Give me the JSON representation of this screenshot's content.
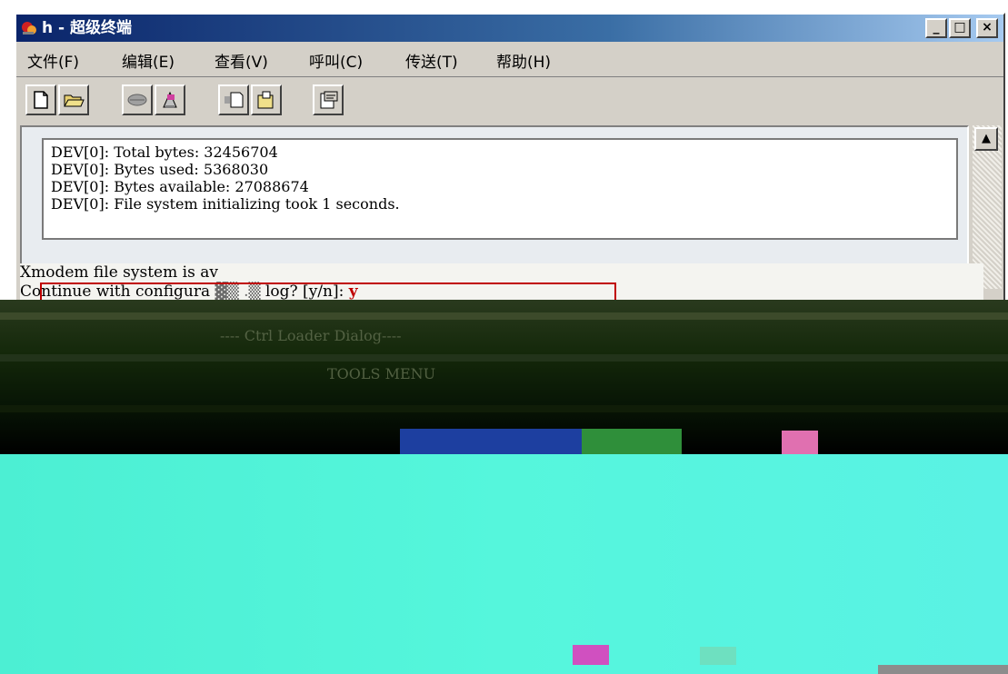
{
  "window": {
    "title": "h - 超级终端",
    "min_label": "_",
    "max_label": "□",
    "close_label": "×"
  },
  "menu": {
    "items": [
      "文件(F)",
      "编辑(E)",
      "查看(V)",
      "呼叫(C)",
      "传送(T)",
      "帮助(H)"
    ]
  },
  "toolbar": {
    "icons": [
      "new-icon",
      "open-icon",
      "disconnect-icon",
      "connect-icon",
      "send-icon",
      "receive-icon",
      "properties-icon"
    ]
  },
  "terminal": {
    "lines": [
      "DEV[0]: Total bytes: 32456704",
      "DEV[0]: Bytes used: 5368030",
      "DEV[0]: Bytes available: 27088674",
      "DEV[0]: File system initializing took 1 seconds."
    ],
    "line5": "Xmodem file system is av",
    "line6_prefix": "Continue with configura",
    "line6_suffix": "log? [y/n]: ",
    "answer": "y",
    "loader_title": "---- Ctrl Loader Dialog----",
    "tools_menu": "TOOLS MENU"
  },
  "colors": {
    "title_bar_start": "#0a246a",
    "highlight": "#c00000",
    "cyan_area": "#55f6dc"
  }
}
